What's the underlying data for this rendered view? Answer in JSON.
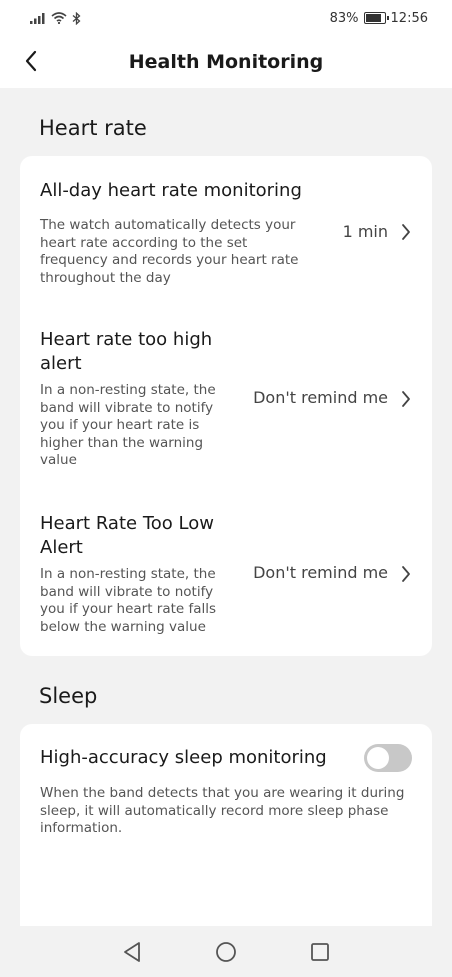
{
  "status": {
    "battery_percent": "83%",
    "time": "12:56"
  },
  "header": {
    "title": "Health Monitoring"
  },
  "heart_rate": {
    "section_title": "Heart rate",
    "items": [
      {
        "title": "All-day heart rate monitoring",
        "description": "The watch automatically detects your heart rate according to the set frequency and records your heart rate throughout the day",
        "value": "1 min"
      },
      {
        "title": "Heart rate too high alert",
        "description": "In a non-resting state, the band will vibrate to notify you if your heart rate is higher than the warning value",
        "value": "Don't remind me"
      },
      {
        "title": "Heart Rate Too Low Alert",
        "description": "In a non-resting state, the band will vibrate to notify you if your heart rate falls below the warning value",
        "value": "Don't remind me"
      }
    ]
  },
  "sleep": {
    "section_title": "Sleep",
    "items": [
      {
        "title": "High-accuracy sleep monitoring",
        "description": "When the band detects that you are wearing it during sleep, it will automatically record more sleep phase information.",
        "enabled": false
      }
    ]
  },
  "colors": {
    "background": "#f2f2f2",
    "card": "#ffffff",
    "toggle_off": "#c8c8c8"
  }
}
